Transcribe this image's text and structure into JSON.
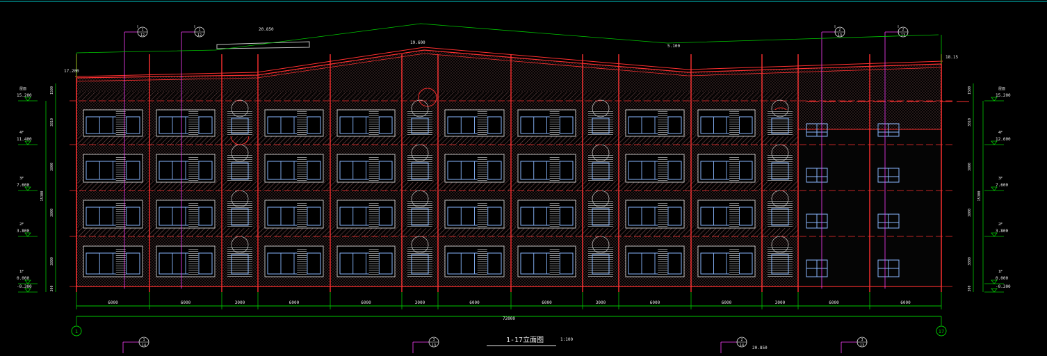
{
  "drawing": {
    "title": "1-17立面图",
    "scale": "1:100",
    "total_dimension": "72000"
  },
  "axes": {
    "start": "1",
    "end": "17"
  },
  "bay_dimensions": [
    "6000",
    "6000",
    "3000",
    "6000",
    "6000",
    "3000",
    "6000",
    "6000",
    "3000",
    "6000",
    "6000",
    "3000",
    "6000",
    "6000"
  ],
  "level_markers_left": [
    {
      "label": "15.200",
      "floor": "屋面"
    },
    {
      "label": "11.400",
      "floor": "4F"
    },
    {
      "label": "7.600",
      "floor": "3F"
    },
    {
      "label": "3.800",
      "floor": "2F"
    },
    {
      "label": "0.000",
      "floor": "1F"
    },
    {
      "label": "-0.300",
      "floor": ""
    }
  ],
  "level_markers_right": [
    {
      "label": "15.200",
      "floor": "屋面"
    },
    {
      "label": "12.600",
      "floor": "4F"
    },
    {
      "label": "7.600",
      "floor": "3F"
    },
    {
      "label": "3.800",
      "floor": "2F"
    },
    {
      "label": "0.000",
      "floor": "1F"
    },
    {
      "label": "-0.300",
      "floor": ""
    }
  ],
  "roof_elevations": {
    "left": "17.200",
    "center": "19.600",
    "right": "18.15",
    "tower": "20.850",
    "slope": "5.100"
  },
  "top_callouts": [
    {
      "num": "1",
      "sheet": "12"
    },
    {
      "num": "1",
      "sheet": "12"
    },
    {
      "num": "2",
      "sheet": "13"
    },
    {
      "num": "2",
      "sheet": "13"
    }
  ],
  "bottom_callouts": [
    {
      "num": "1",
      "sheet": "14"
    },
    {
      "num": "3",
      "sheet": "13"
    },
    {
      "num": "2",
      "sheet": "14"
    },
    {
      "num": "3",
      "sheet": "13"
    }
  ],
  "bottom_note": "20.850",
  "left_total": "15300",
  "right_total": "15300",
  "left_chain": [
    "1500",
    "3810",
    "3800",
    "3800",
    "3800",
    "300"
  ],
  "right_chain": [
    "1500",
    "3810",
    "3800",
    "3800",
    "3800",
    "300"
  ],
  "colors": {
    "background": "#000000",
    "outline": "#ff3030",
    "hatch": "#9a6a6a",
    "dimension": "#00c800",
    "window": "#8ab8ff",
    "callout": "#ff40ff",
    "text": "#e8e8e8"
  }
}
